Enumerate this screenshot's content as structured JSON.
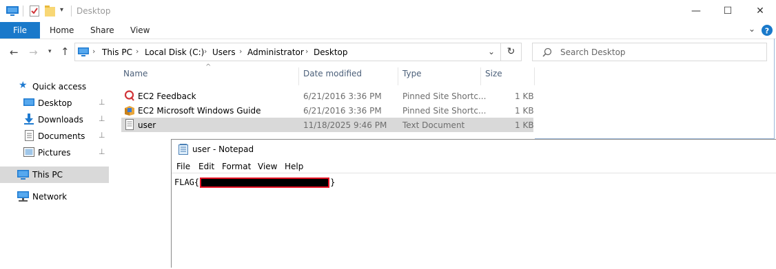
{
  "explorer": {
    "title": "Desktop",
    "window_controls": {
      "minimize": "—",
      "maximize": "☐",
      "close": "✕"
    },
    "ribbon_tabs": {
      "file": "File",
      "home": "Home",
      "share": "Share",
      "view": "View"
    },
    "address": {
      "crumbs": [
        "This PC",
        "Local Disk (C:)",
        "Users",
        "Administrator",
        "Desktop"
      ],
      "separator": "›"
    },
    "search_placeholder": "Search Desktop",
    "nav": {
      "quick_access": "Quick access",
      "desktop": "Desktop",
      "downloads": "Downloads",
      "documents": "Documents",
      "pictures": "Pictures",
      "this_pc": "This PC",
      "network": "Network",
      "pin_glyph": "📌"
    },
    "columns": {
      "name": "Name",
      "date": "Date modified",
      "type": "Type",
      "size": "Size"
    },
    "files": [
      {
        "name": "EC2 Feedback",
        "date": "6/21/2016 3:36 PM",
        "type": "Pinned Site Shortc...",
        "size": "1 KB",
        "icon": "feedback-icon"
      },
      {
        "name": "EC2 Microsoft Windows Guide",
        "date": "6/21/2016 3:36 PM",
        "type": "Pinned Site Shortc...",
        "size": "1 KB",
        "icon": "guide-icon"
      },
      {
        "name": "user",
        "date": "11/18/2025 9:46 PM",
        "type": "Text Document",
        "size": "1 KB",
        "icon": "text-document-icon"
      }
    ],
    "colors": {
      "accent": "#1979ca",
      "selected": "#d9d9d9",
      "header_text": "#4c607a"
    }
  },
  "notepad": {
    "title": "user - Notepad",
    "menu": {
      "file": "File",
      "edit": "Edit",
      "format": "Format",
      "view": "View",
      "help": "Help"
    },
    "content_prefix": "FLAG{",
    "content_suffix": "}"
  }
}
